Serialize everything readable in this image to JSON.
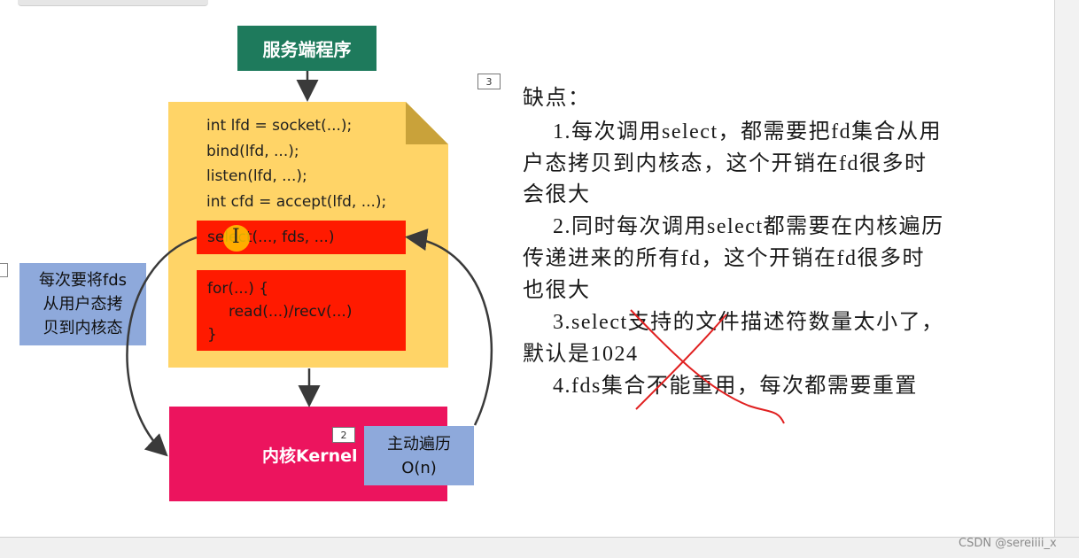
{
  "server": {
    "title": "服务端程序"
  },
  "code": {
    "lines": [
      "int lfd = socket(...);",
      "bind(lfd, ...);",
      "listen(lfd, ...);",
      "int cfd = accept(lfd, ...);"
    ],
    "select_call": "select(..., fds, ...)",
    "loop_lines": [
      "for(...) {",
      "read(...)/recv(...)",
      "}"
    ]
  },
  "kernel": {
    "label": "内核Kernel",
    "tag": "2"
  },
  "left_note": {
    "lines": [
      "每次要将fds",
      "从用户态拷",
      "贝到内核态"
    ]
  },
  "right_note": {
    "lines": [
      "主动遍历",
      "O(n)"
    ]
  },
  "notes": {
    "tag": "3",
    "title": "缺点：",
    "lines": [
      "1.每次调用select，都需要把fd集合从用",
      "户态拷贝到内核态，这个开销在fd很多时",
      "会很大",
      "2.同时每次调用select都需要在内核遍历",
      "传递进来的所有fd，这个开销在fd很多时",
      "也很大",
      "3.select支持的文件描述符数量太小了，",
      "默认是1024",
      "4.fds集合不能重用，每次都需要重置"
    ]
  },
  "watermark": "CSDN @sereiiii_x",
  "colors": {
    "server": "#1e7a5c",
    "doc": "#ffd467",
    "highlight": "#ff1a00",
    "kernel": "#ec145e",
    "note": "#8ea9db",
    "annotation": "#e02020"
  }
}
